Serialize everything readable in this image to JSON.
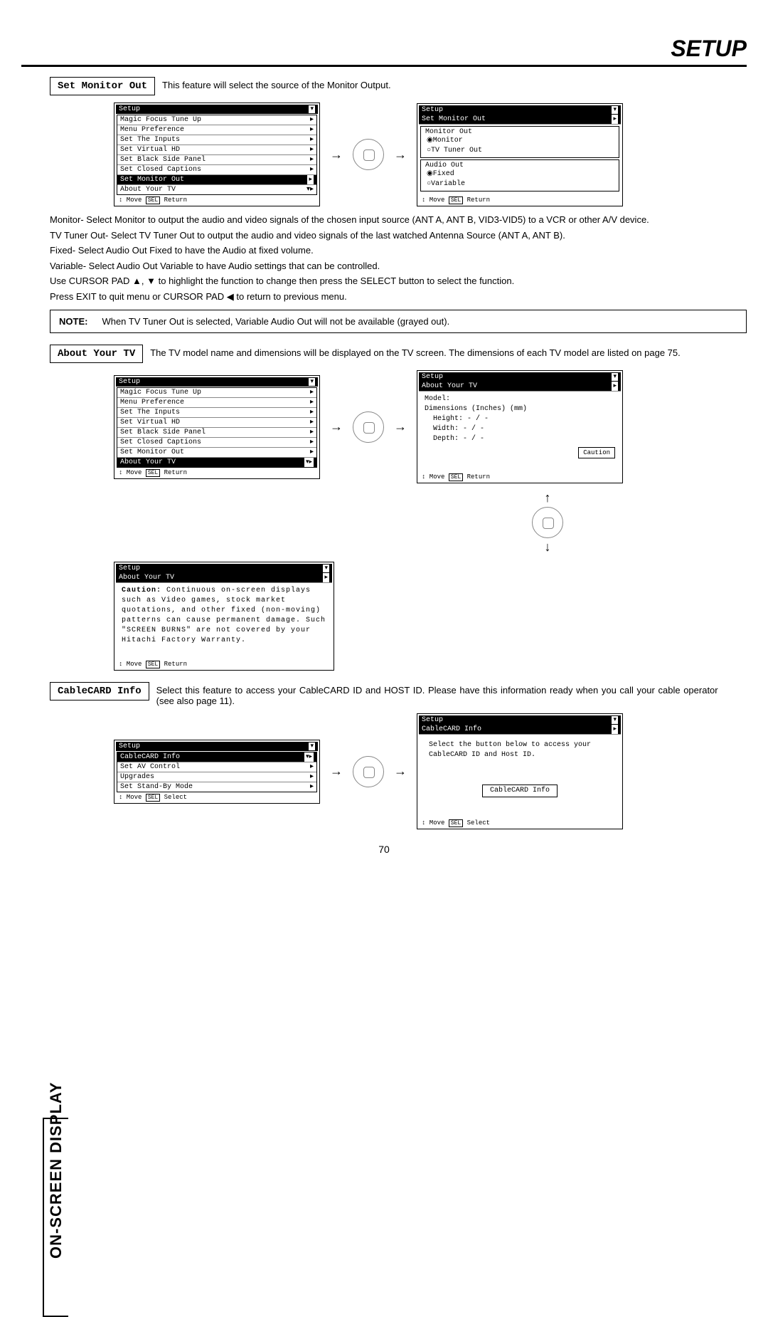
{
  "header": {
    "title": "SETUP"
  },
  "sideTab": "ON-SCREEN DISPLAY",
  "pageNumber": "70",
  "sections": {
    "setMonitorOut": {
      "label": "Set Monitor Out",
      "desc": "This feature will select the source of the Monitor Output."
    },
    "aboutYourTV": {
      "label": "About Your TV",
      "desc": "The TV model name and dimensions will be displayed on the TV screen.  The dimensions of each TV model are listed on page 75."
    },
    "cableCard": {
      "label": "CableCARD Info",
      "desc": "Select this feature to access your CableCARD ID and HOST ID.  Please have this information ready when you call your cable operator (see also page 11)."
    }
  },
  "paragraphs": {
    "monitor": "Monitor- Select Monitor to output the audio and video signals of the chosen input source (ANT A, ANT B, VID3-VID5) to a VCR or other A/V device.",
    "tvTuner": "TV Tuner Out- Select TV Tuner Out to output the audio and video signals of the last watched Antenna Source (ANT A, ANT B).",
    "fixed": "Fixed-  Select Audio Out Fixed to have the Audio at fixed volume.",
    "variable": "Variable- Select Audio Out Variable to have Audio settings that can be controlled.",
    "cursor": "Use CURSOR PAD ▲, ▼ to highlight the function to change then press the SELECT button to select the function.",
    "exit": "Press EXIT to quit menu or CURSOR PAD ◀ to return to previous menu."
  },
  "note": {
    "label": "NOTE:",
    "text": "When TV Tuner Out is selected, Variable Audio Out will not be available (grayed out)."
  },
  "osd": {
    "setupTitle": "Setup",
    "footerMove": "↕ Move",
    "footerSel": "SEL",
    "footerReturn": "Return",
    "footerSelect": "Select",
    "menu1": {
      "items": [
        "Magic Focus Tune Up",
        "Menu Preference",
        "Set The Inputs",
        "Set Virtual HD",
        "Set Black Side Panel",
        "Set Closed Captions",
        "Set Monitor Out",
        "About Your TV"
      ],
      "hl": "Set Monitor Out"
    },
    "monitorOut": {
      "title": "Set Monitor Out",
      "g1": "Monitor Out",
      "g1o1": "◉Monitor",
      "g1o2": "○TV Tuner Out",
      "g2": "Audio Out",
      "g2o1": "◉Fixed",
      "g2o2": "○Variable"
    },
    "menu2": {
      "items": [
        "Magic Focus Tune Up",
        "Menu Preference",
        "Set The Inputs",
        "Set Virtual HD",
        "Set Black Side Panel",
        "Set Closed Captions",
        "Set Monitor Out",
        "About Your TV"
      ],
      "hl": "About Your TV"
    },
    "aboutInfo": {
      "title": "About Your TV",
      "model": "Model:",
      "dims": "Dimensions  (Inches) (mm)",
      "height": "Height:      - / -",
      "width": "Width:      - / -",
      "depth": "Depth:      - / -",
      "cautionBtn": "Caution"
    },
    "caution": {
      "title": "About Your TV",
      "boldLabel": "Caution:",
      "text": "Continuous on-screen displays such as Video games, stock market quotations, and other fixed (non-moving) patterns can cause permanent damage. Such \"SCREEN BURNS\" are not covered by your Hitachi Factory Warranty."
    },
    "cableMenu": {
      "items": [
        "CableCARD Info",
        "Set AV Control",
        "Upgrades",
        "Set Stand-By Mode"
      ],
      "hl": "CableCARD Info"
    },
    "cableInfo": {
      "title": "CableCARD Info",
      "text": "Select the button below to access your CableCARD ID and Host ID.",
      "btn": "CableCARD Info"
    }
  }
}
